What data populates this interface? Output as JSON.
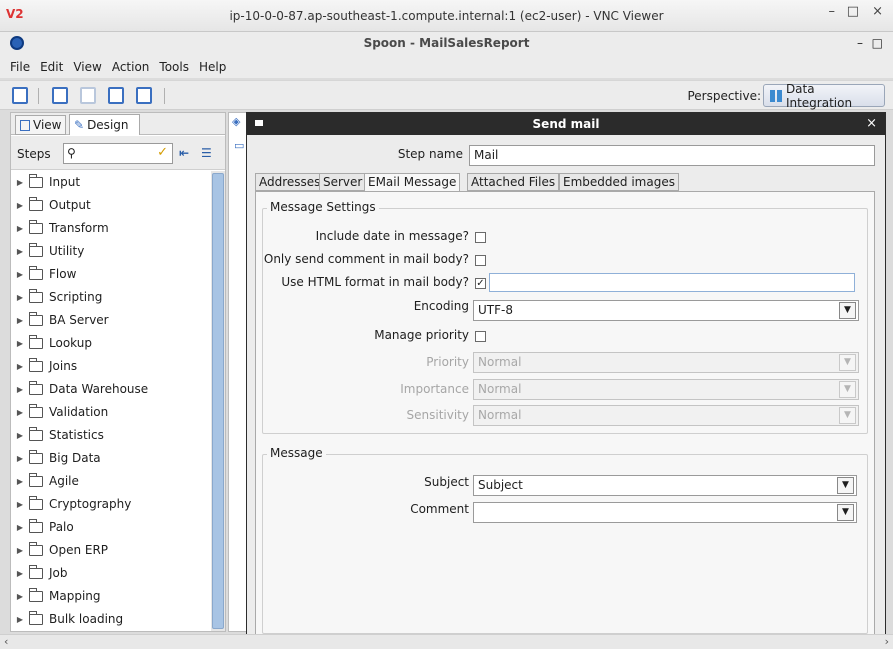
{
  "vnc": {
    "logo": "V2",
    "title": "ip-10-0-0-87.ap-southeast-1.compute.internal:1 (ec2-user) - VNC Viewer",
    "minimize": "–",
    "maximize": "□",
    "close": "×"
  },
  "spoon": {
    "title": "Spoon - MailSalesReport",
    "minimize": "–",
    "maximize": "□"
  },
  "menu": [
    "File",
    "Edit",
    "View",
    "Action",
    "Tools",
    "Help"
  ],
  "toolbar": {
    "perspective_label": "Perspective:",
    "perspective_value": "Data Integration"
  },
  "left": {
    "tab_view": "View",
    "tab_design": "Design",
    "steps_label": "Steps",
    "steps_search": "",
    "tree": [
      "Input",
      "Output",
      "Transform",
      "Utility",
      "Flow",
      "Scripting",
      "BA Server",
      "Lookup",
      "Joins",
      "Data Warehouse",
      "Validation",
      "Statistics",
      "Big Data",
      "Agile",
      "Cryptography",
      "Palo",
      "Open ERP",
      "Job",
      "Mapping",
      "Bulk loading"
    ]
  },
  "dialog": {
    "title": "Send mail",
    "step_name_label": "Step name",
    "step_name_value": "Mail",
    "tabs": [
      "Addresses",
      "Server",
      "EMail Message",
      "Attached Files",
      "Embedded images"
    ],
    "active_tab": "EMail Message",
    "message_settings": {
      "title": "Message Settings",
      "include_date_label": "Include date in message?",
      "include_date_checked": false,
      "only_comment_label": "Only send comment in mail body?",
      "only_comment_checked": false,
      "use_html_label": "Use HTML format in mail body?",
      "use_html_checked": true,
      "use_html_value": "",
      "encoding_label": "Encoding",
      "encoding_value": "UTF-8",
      "manage_priority_label": "Manage priority",
      "manage_priority_checked": false,
      "priority_label": "Priority",
      "priority_value": "Normal",
      "importance_label": "Importance",
      "importance_value": "Normal",
      "sensitivity_label": "Sensitivity",
      "sensitivity_value": "Normal"
    },
    "message": {
      "title": "Message",
      "subject_label": "Subject",
      "subject_value": "Subject",
      "comment_label": "Comment",
      "comment_value": ""
    }
  }
}
